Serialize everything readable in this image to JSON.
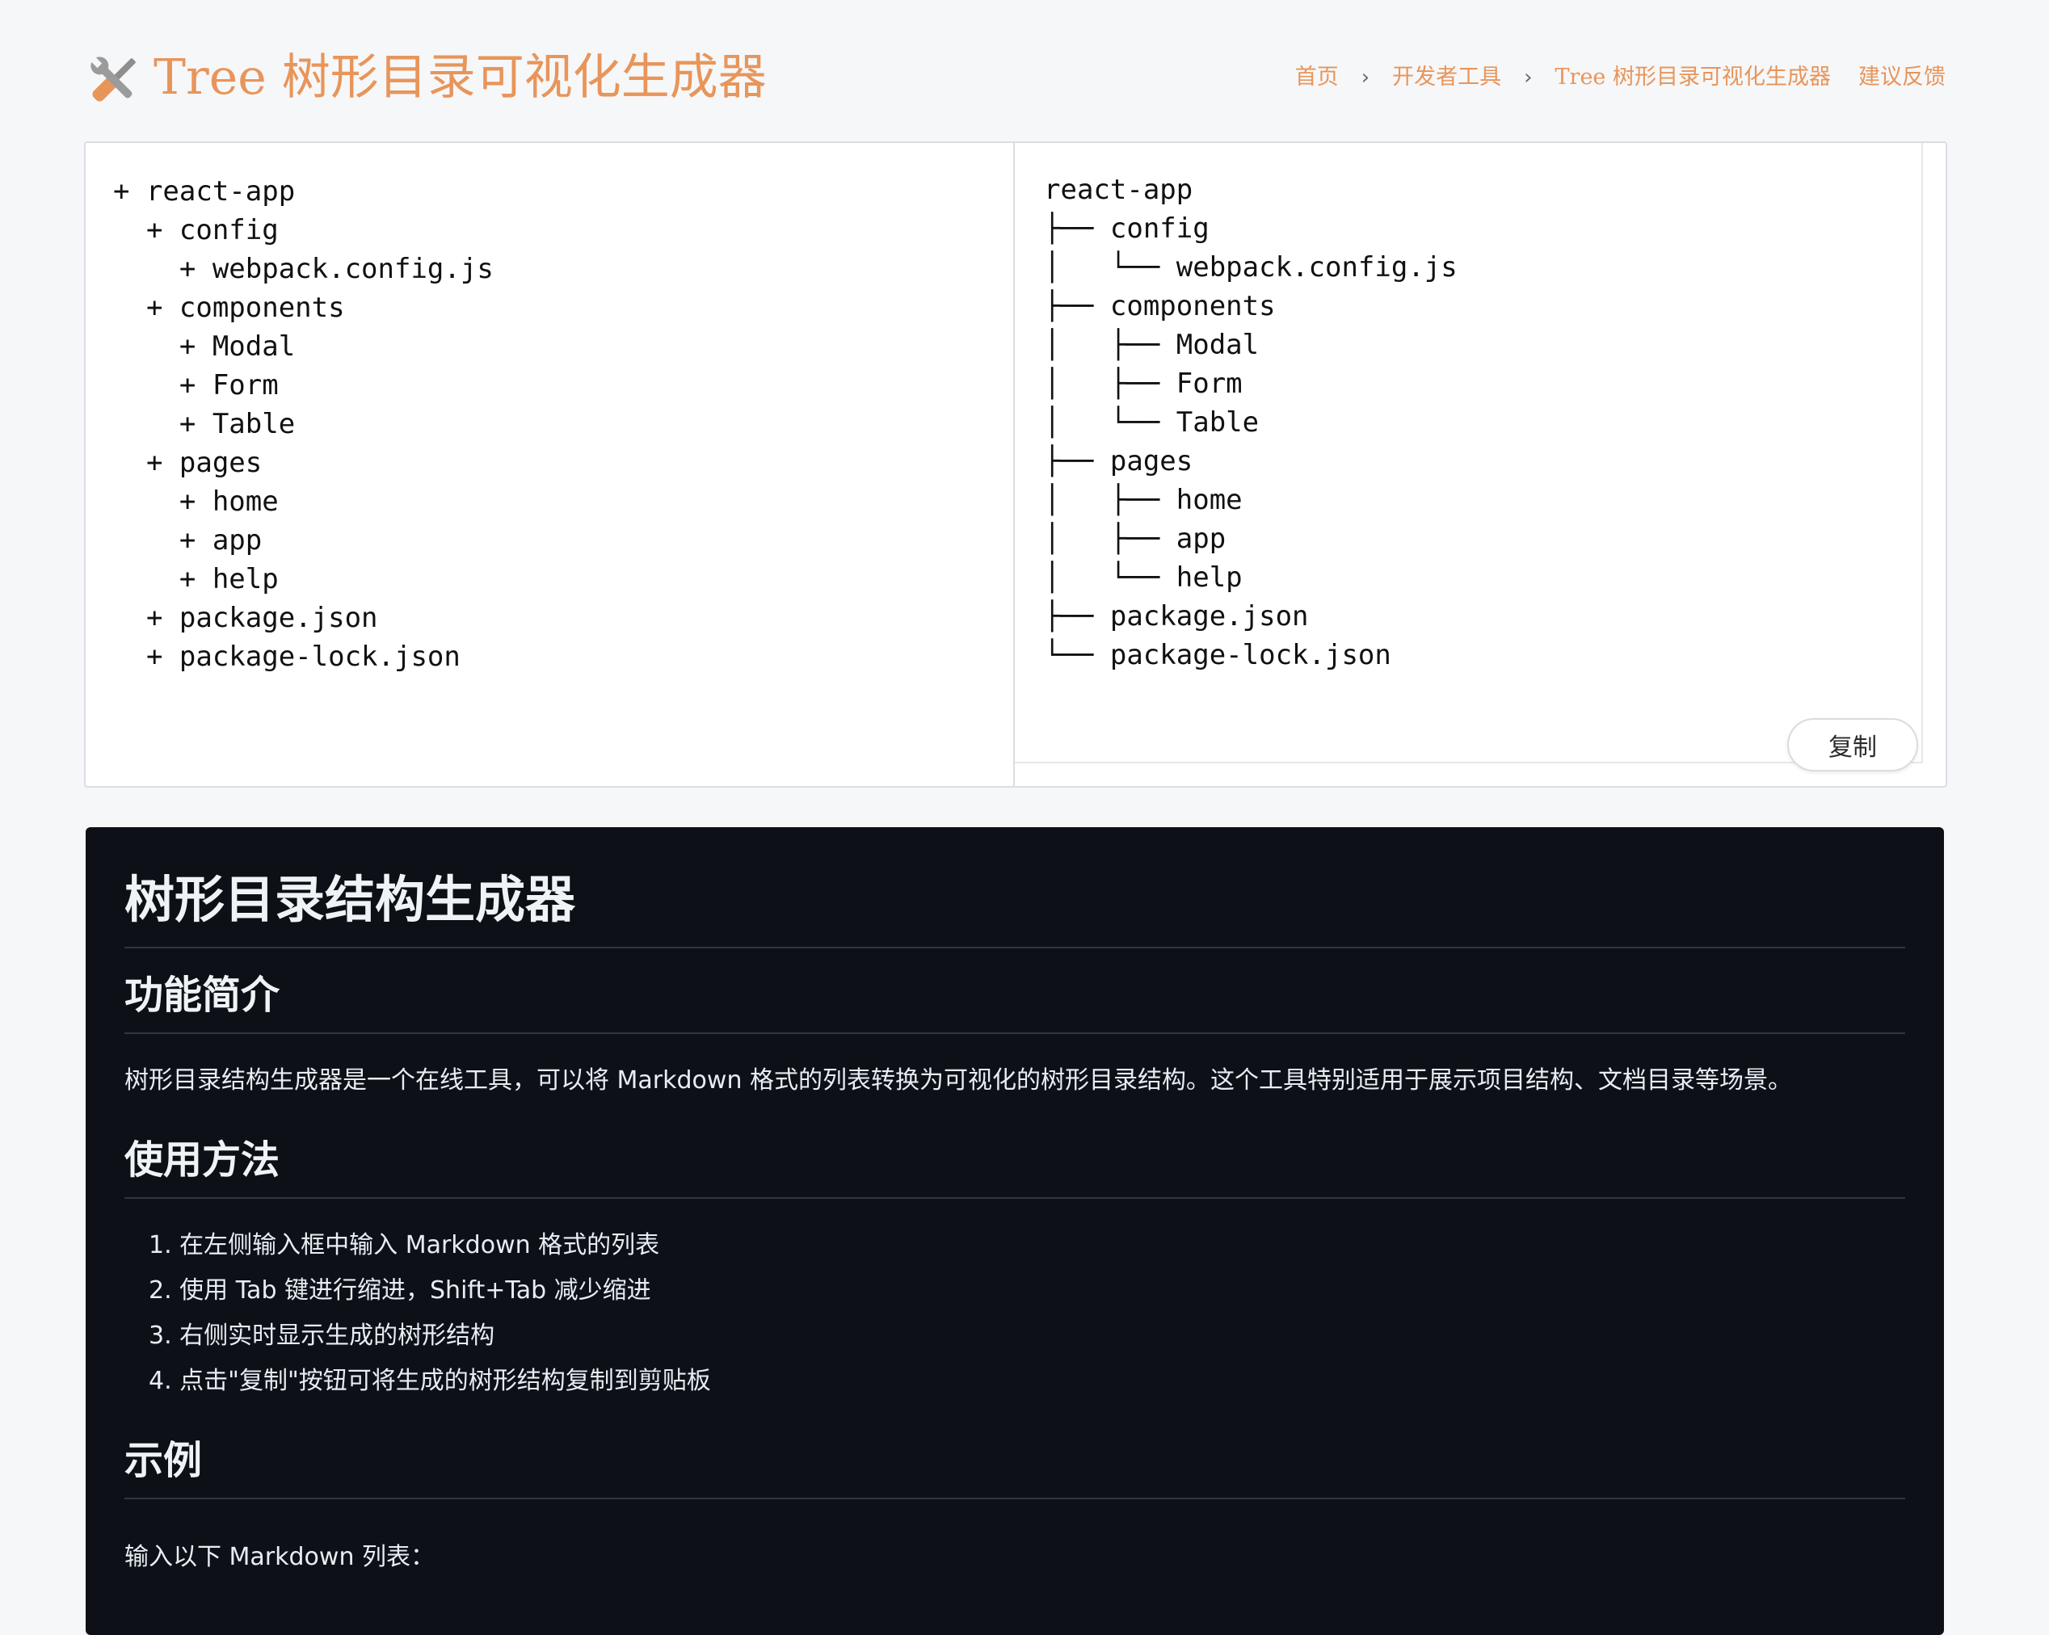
{
  "header": {
    "title": "Tree 树形目录可视化生成器",
    "logo_icon": "tools-icon",
    "accent_color": "#e8955a",
    "breadcrumb": [
      "首页",
      "开发者工具",
      "Tree 树形目录可视化生成器"
    ],
    "feedback_label": "建议反馈"
  },
  "editor": {
    "input_lines": [
      "+ react-app",
      "  + config",
      "    + webpack.config.js",
      "  + components",
      "    + Modal",
      "    + Form",
      "    + Table",
      "  + pages",
      "    + home",
      "    + app",
      "    + help",
      "  + package.json",
      "  + package-lock.json"
    ],
    "output_lines": [
      "react-app",
      "├── config",
      "│   └── webpack.config.js",
      "├── components",
      "│   ├── Modal",
      "│   ├── Form",
      "│   └── Table",
      "├── pages",
      "│   ├── home",
      "│   ├── app",
      "│   └── help",
      "├── package.json",
      "└── package-lock.json"
    ],
    "copy_label": "复制"
  },
  "docs": {
    "title": "树形目录结构生成器",
    "intro_heading": "功能简介",
    "intro_text": "树形目录结构生成器是一个在线工具，可以将 Markdown 格式的列表转换为可视化的树形目录结构。这个工具特别适用于展示项目结构、文档目录等场景。",
    "usage_heading": "使用方法",
    "usage_steps": [
      "1. 在左侧输入框中输入 Markdown 格式的列表",
      "2. 使用 Tab 键进行缩进，Shift+Tab 减少缩进",
      "3. 右侧实时显示生成的树形结构",
      "4. 点击\"复制\"按钮可将生成的树形结构复制到剪贴板"
    ],
    "example_heading": "示例",
    "example_text": "输入以下 Markdown 列表："
  }
}
